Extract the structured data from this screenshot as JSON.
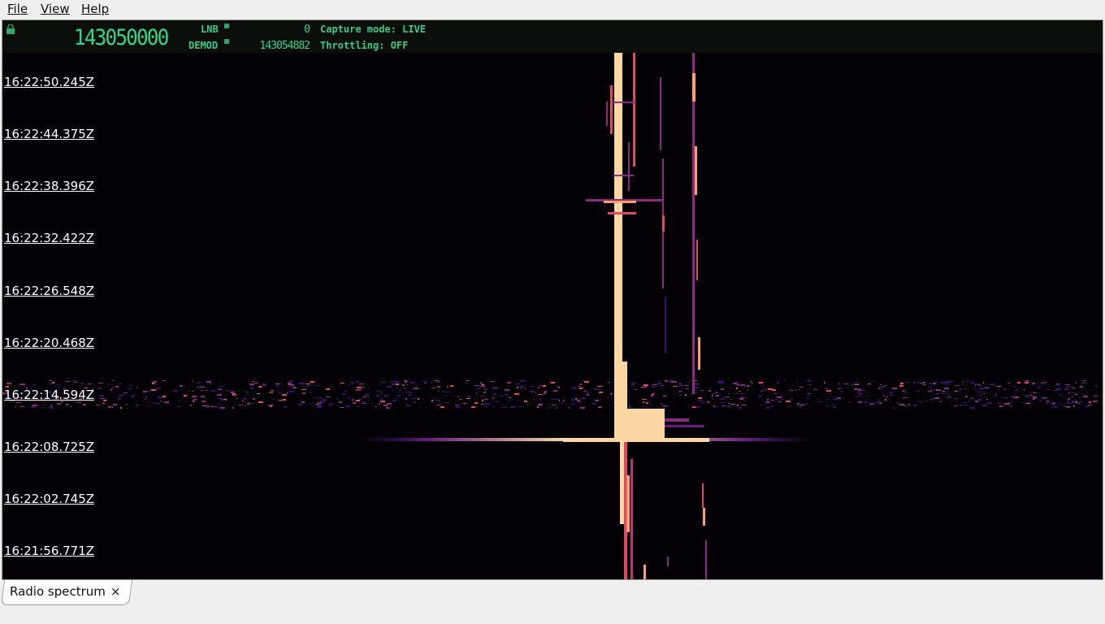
{
  "menu": [
    {
      "label": "File"
    },
    {
      "label": "View"
    },
    {
      "label": "Help"
    }
  ],
  "header": {
    "main_frequency": "143050000",
    "lnb_label": "LNB",
    "lnb_value": "0",
    "demod_label": "DEMOD",
    "demod_value": "143054882",
    "capture_mode": "Capture mode: LIVE",
    "throttling": "Throttling: OFF",
    "lcd_color": "#34d68b"
  },
  "waterfall": {
    "timestamps": [
      "16:22:50.245Z",
      "16:22:44.375Z",
      "16:22:38.396Z",
      "16:22:32.422Z",
      "16:22:26.548Z",
      "16:22:20.468Z",
      "16:22:14.594Z",
      "16:22:08.725Z",
      "16:22:02.745Z",
      "16:21:56.771Z"
    ],
    "colormap": [
      "#030106",
      "#3b0f70",
      "#8c2981",
      "#de4968",
      "#fe9f6d",
      "#fcd7a4"
    ]
  },
  "tabs": [
    {
      "label": "Radio spectrum",
      "close": "×"
    }
  ]
}
